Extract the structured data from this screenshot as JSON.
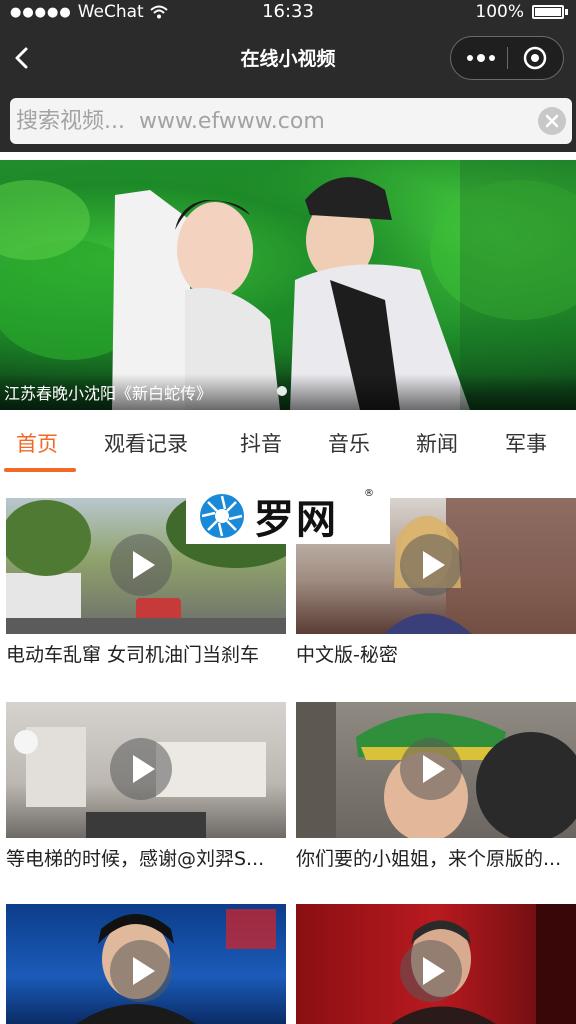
{
  "status_bar": {
    "carrier": "WeChat",
    "time": "16:33",
    "battery": "100%"
  },
  "nav": {
    "title": "在线小视频"
  },
  "search": {
    "placeholder": "搜索视频...  www.efwww.com"
  },
  "banner": {
    "caption": "江苏春晚小沈阳《新白蛇传》"
  },
  "tabs": [
    {
      "label": "首页",
      "active": true
    },
    {
      "label": "观看记录",
      "active": false
    },
    {
      "label": "抖音",
      "active": false
    },
    {
      "label": "音乐",
      "active": false
    },
    {
      "label": "新闻",
      "active": false
    },
    {
      "label": "军事",
      "active": false
    }
  ],
  "videos": [
    {
      "title": "电动车乱窜 女司机油门当刹车"
    },
    {
      "title": "中文版-秘密"
    },
    {
      "title": "等电梯的时候，感谢@刘羿S..."
    },
    {
      "title": "你们要的小姐姐，来个原版的..."
    },
    {
      "title": ""
    },
    {
      "title": ""
    }
  ],
  "watermark": {
    "text": "罗网",
    "reg": "®"
  },
  "colors": {
    "accent": "#f16a25",
    "header_bg": "#2b2b2b"
  }
}
